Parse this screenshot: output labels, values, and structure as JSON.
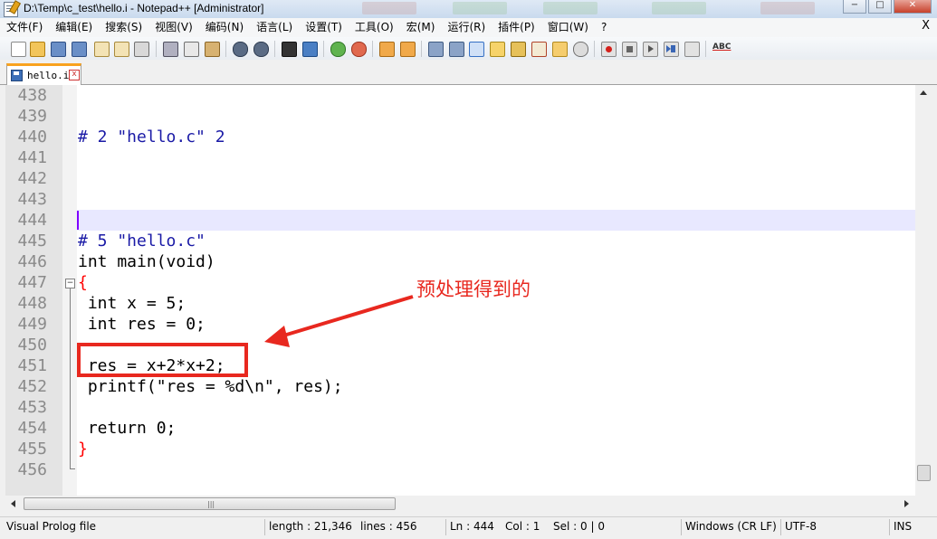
{
  "window": {
    "title": "D:\\Temp\\c_test\\hello.i - Notepad++ [Administrator]",
    "controls": [
      "−",
      "□",
      "✕"
    ]
  },
  "menu": {
    "items": [
      "文件(F)",
      "编辑(E)",
      "搜索(S)",
      "视图(V)",
      "编码(N)",
      "语言(L)",
      "设置(T)",
      "工具(O)",
      "宏(M)",
      "运行(R)",
      "插件(P)",
      "窗口(W)",
      "?"
    ],
    "close": "X"
  },
  "toolbar": {
    "icons": [
      "new-file-icon",
      "open-file-icon",
      "save-icon",
      "save-all-icon",
      "close-icon",
      "close-all-icon",
      "print-icon",
      "cut-icon",
      "copy-icon",
      "paste-icon",
      "undo-icon",
      "redo-icon",
      "find-icon",
      "replace-icon",
      "zoom-in-icon",
      "zoom-out-icon",
      "sync-v-icon",
      "sync-h-icon",
      "word-wrap-icon",
      "show-all-chars-icon",
      "indent-guide-icon",
      "udl-icon",
      "doc-map-icon",
      "function-list-icon",
      "folder-workspace-icon",
      "monitoring-icon",
      "record-macro-icon",
      "stop-macro-icon",
      "play-macro-icon",
      "run-macro-multiple-icon",
      "save-macro-icon",
      "spell-check-icon"
    ],
    "spellcheck_label": "ABC"
  },
  "tab": {
    "label": "hello.i",
    "close": "x"
  },
  "editor": {
    "current_line": 444,
    "lines": [
      {
        "n": "438",
        "text": ""
      },
      {
        "n": "439",
        "text": ""
      },
      {
        "n": "440",
        "text": "# 2 \"hello.c\" 2"
      },
      {
        "n": "441",
        "text": ""
      },
      {
        "n": "442",
        "text": ""
      },
      {
        "n": "443",
        "text": ""
      },
      {
        "n": "444",
        "text": ""
      },
      {
        "n": "445",
        "text": "# 5 \"hello.c\""
      },
      {
        "n": "446",
        "text": "int main(void)"
      },
      {
        "n": "447",
        "text": "{"
      },
      {
        "n": "448",
        "text": " int x = 5;"
      },
      {
        "n": "449",
        "text": " int res = 0;"
      },
      {
        "n": "450",
        "text": ""
      },
      {
        "n": "451",
        "text": " res = x+2*x+2;"
      },
      {
        "n": "452",
        "text": " printf(\"res = %d\\n\", res);"
      },
      {
        "n": "453",
        "text": ""
      },
      {
        "n": "454",
        "text": " return 0;"
      },
      {
        "n": "455",
        "text": "}"
      },
      {
        "n": "456",
        "text": ""
      }
    ]
  },
  "annotation": {
    "text": "预处理得到的",
    "color": "#e8281f"
  },
  "status": {
    "file_type": "Visual Prolog file",
    "length": "length : 21,346",
    "lines": "lines : 456",
    "ln": "Ln : 444",
    "col": "Col : 1",
    "sel": "Sel : 0 | 0",
    "eol": "Windows (CR LF)",
    "encoding": "UTF-8",
    "mode": "INS"
  }
}
